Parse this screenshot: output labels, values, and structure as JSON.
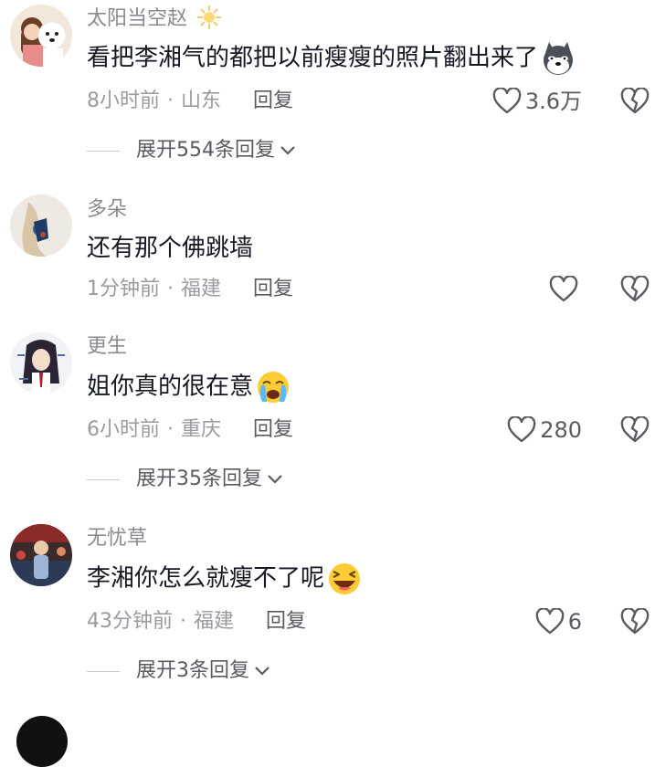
{
  "comments": [
    {
      "username": "太阳当空赵",
      "username_badge": "sun-badge-icon",
      "text": "看把李湘气的都把以前瘦瘦的照片翻出来了",
      "emoji": "husky-dog-emoji",
      "time": "8小时前",
      "location": "山东",
      "reply_label": "回复",
      "likes": "3.6万",
      "expand_label": "展开554条回复"
    },
    {
      "username": "多朵",
      "text": "还有那个佛跳墙",
      "time": "1分钟前",
      "location": "福建",
      "reply_label": "回复",
      "likes": ""
    },
    {
      "username": "更生",
      "text": "姐你真的很在意",
      "emoji": "crying-face-emoji",
      "time": "6小时前",
      "location": "重庆",
      "reply_label": "回复",
      "likes": "280",
      "expand_label": "展开35条回复"
    },
    {
      "username": "无忧草",
      "text": "李湘你怎么就瘦不了呢",
      "emoji": "laughing-face-emoji",
      "time": "43分钟前",
      "location": "福建",
      "reply_label": "回复",
      "likes": "6",
      "expand_label": "展开3条回复"
    }
  ],
  "colors": {
    "text_primary": "#161823",
    "text_secondary": "#8a8b91",
    "meta": "#9a9ba1",
    "icon": "#5a5b61"
  }
}
